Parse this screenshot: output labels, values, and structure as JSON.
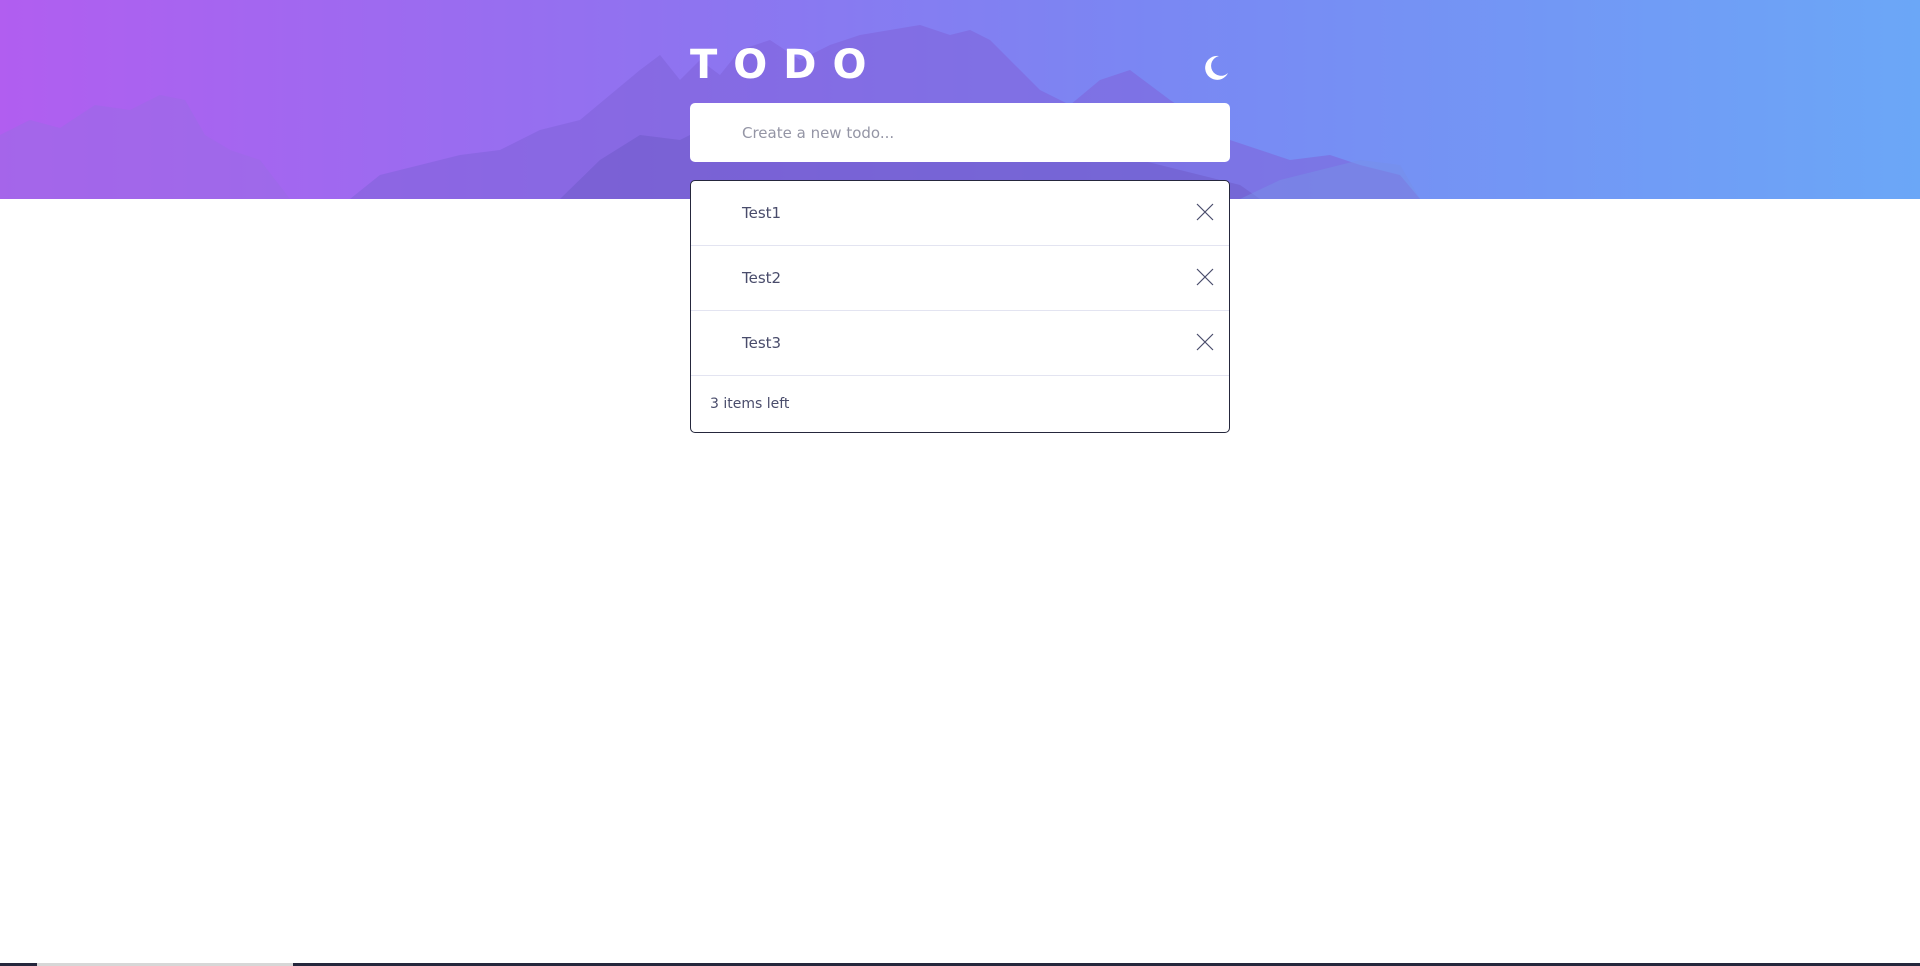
{
  "app": {
    "title": "TODO"
  },
  "theme_toggle": {
    "icon": "moon-icon"
  },
  "new_todo": {
    "placeholder": "Create a new todo...",
    "value": ""
  },
  "todos": [
    {
      "text": "Test1"
    },
    {
      "text": "Test2"
    },
    {
      "text": "Test3"
    }
  ],
  "footer": {
    "items_left": "3 items left"
  },
  "colors": {
    "gradient_start": "#b15ef0",
    "gradient_end": "#6ba7f7",
    "text": "#494c6b",
    "border": "#e3e4f1"
  }
}
